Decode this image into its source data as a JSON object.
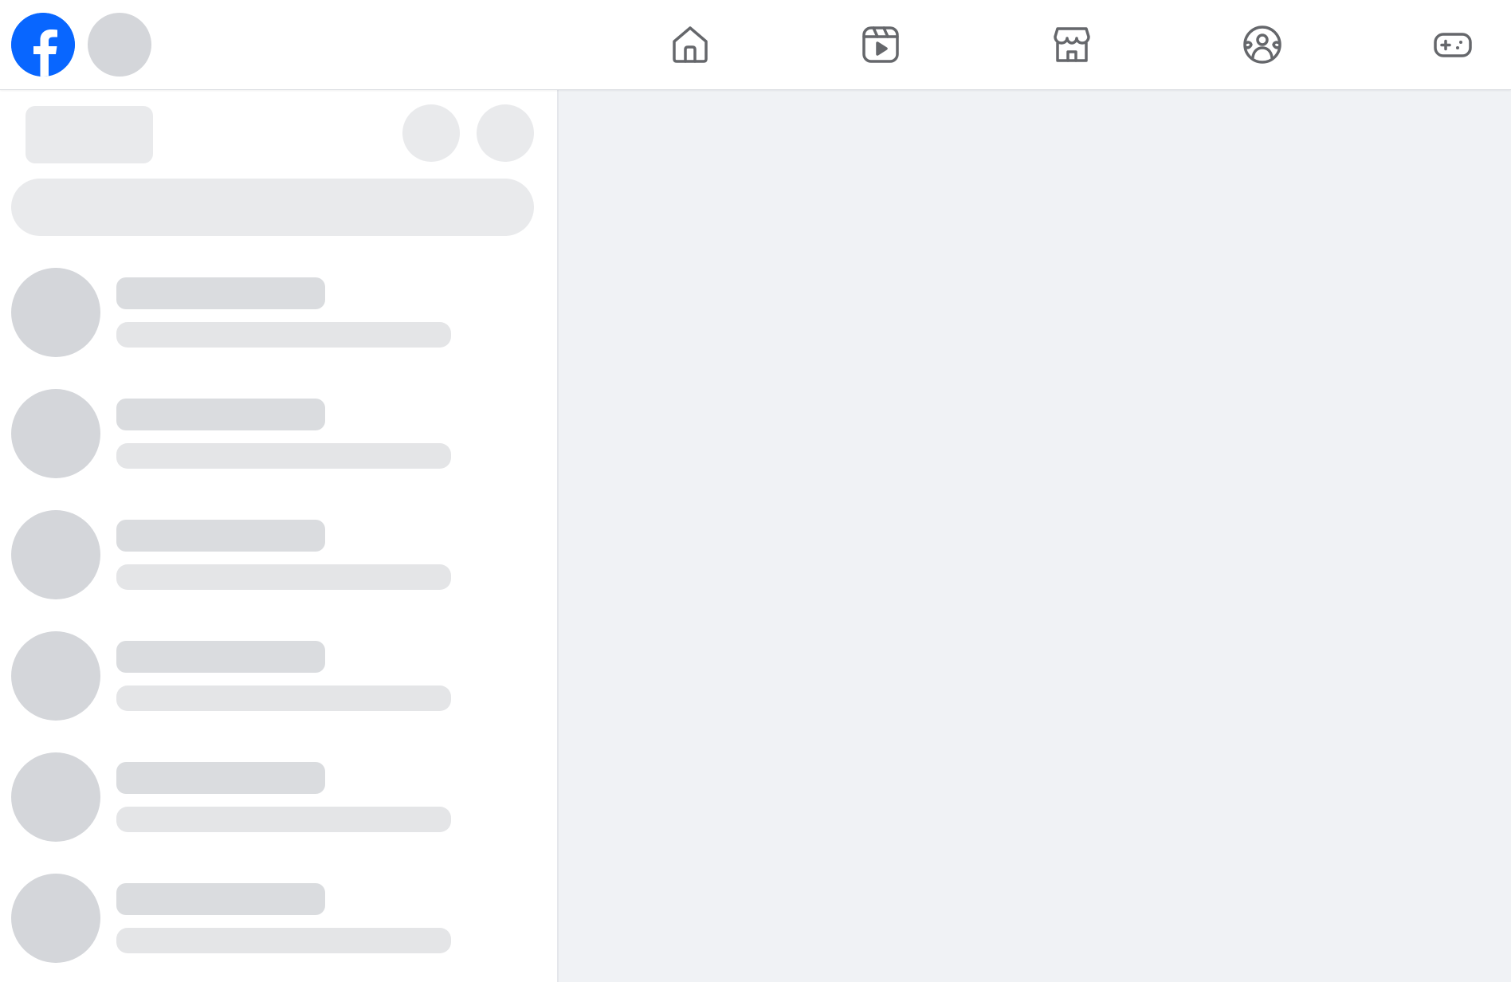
{
  "app": {
    "brand": "facebook",
    "brand_color": "#0866ff"
  },
  "topbar": {
    "logo_icon": "facebook-logo-icon",
    "nav": [
      {
        "icon": "home-icon"
      },
      {
        "icon": "reels-video-icon"
      },
      {
        "icon": "marketplace-store-icon"
      },
      {
        "icon": "groups-icon"
      },
      {
        "icon": "gaming-controller-icon"
      }
    ]
  },
  "sidebar": {
    "state": "loading",
    "placeholder_rows": 6
  },
  "colors": {
    "background": "#f0f2f5",
    "surface": "#ffffff",
    "skeleton": "#e9eaec",
    "skeleton_dark": "#d4d6da",
    "icon_gray": "#65676b"
  }
}
